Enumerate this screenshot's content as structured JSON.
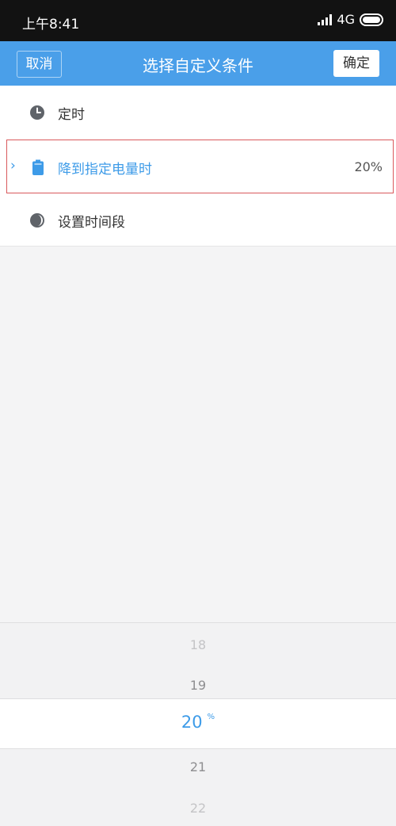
{
  "status": {
    "time": "上午8:41",
    "network": "4G"
  },
  "nav": {
    "cancel": "取消",
    "title": "选择自定义条件",
    "confirm": "确定"
  },
  "conditions": [
    {
      "icon": "clock-icon",
      "label": "定时"
    },
    {
      "icon": "battery-icon",
      "label": "降到指定电量时",
      "value": "20%"
    },
    {
      "icon": "moon-icon",
      "label": "设置时间段"
    }
  ],
  "picker": {
    "items": [
      "18",
      "19",
      "20",
      "21",
      "22"
    ],
    "selected": "20",
    "unit": "%"
  },
  "colors": {
    "accent": "#4a9fe9",
    "selected_text": "#3d9be8",
    "highlight_border": "#d9595c"
  }
}
